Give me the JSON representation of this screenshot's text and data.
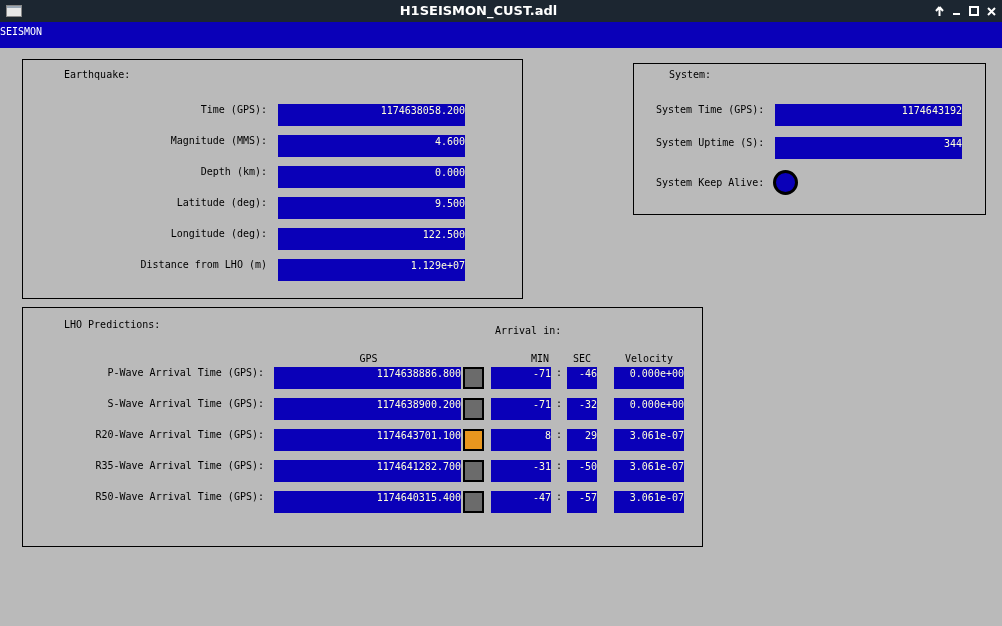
{
  "window": {
    "title": "H1SEISMON_CUST.adl"
  },
  "menu_bar": {
    "label": "SEISMON"
  },
  "earthquake": {
    "title": "Earthquake:",
    "fields": [
      {
        "label": "Time (GPS):",
        "value": "1174638058.200"
      },
      {
        "label": "Magnitude (MMS):",
        "value": "4.600"
      },
      {
        "label": "Depth (km):",
        "value": "0.000"
      },
      {
        "label": "Latitude (deg):",
        "value": "9.500"
      },
      {
        "label": "Longitude (deg):",
        "value": "122.500"
      },
      {
        "label": "Distance from LHO (m)",
        "value": "1.129e+07"
      }
    ]
  },
  "system": {
    "title": "System:",
    "fields": [
      {
        "label": "System Time (GPS):",
        "value": "1174643192"
      },
      {
        "label": "System Uptime (S):",
        "value": "344"
      }
    ],
    "keep_alive": {
      "label": "System Keep Alive:",
      "color": "#0a00b8"
    }
  },
  "predictions": {
    "title": "LHO Predictions:",
    "arrival_label": "Arrival in:",
    "columns": [
      "GPS",
      "MIN",
      "SEC",
      "Velocity"
    ],
    "rows": [
      {
        "label": "P-Wave Arrival Time (GPS):",
        "gps": "1174638886.800",
        "color": "#6b6b6b",
        "min": "-71",
        "separator": ":",
        "sec": "-46",
        "velocity": "0.000e+00"
      },
      {
        "label": "S-Wave Arrival Time (GPS):",
        "gps": "1174638900.200",
        "color": "#6b6b6b",
        "min": "-71",
        "separator": ":",
        "sec": "-32",
        "velocity": "0.000e+00"
      },
      {
        "label": "R20-Wave Arrival Time (GPS):",
        "gps": "1174643701.100",
        "color": "#e8961e",
        "min": "8",
        "separator": ":",
        "sec": "29",
        "velocity": "3.061e-07"
      },
      {
        "label": "R35-Wave Arrival Time (GPS):",
        "gps": "1174641282.700",
        "color": "#6b6b6b",
        "min": "-31",
        "separator": ":",
        "sec": "-50",
        "velocity": "3.061e-07"
      },
      {
        "label": "R50-Wave Arrival Time (GPS):",
        "gps": "1174640315.400",
        "color": "#6b6b6b",
        "min": "-47",
        "separator": ":",
        "sec": "-57",
        "velocity": "3.061e-07"
      }
    ]
  }
}
